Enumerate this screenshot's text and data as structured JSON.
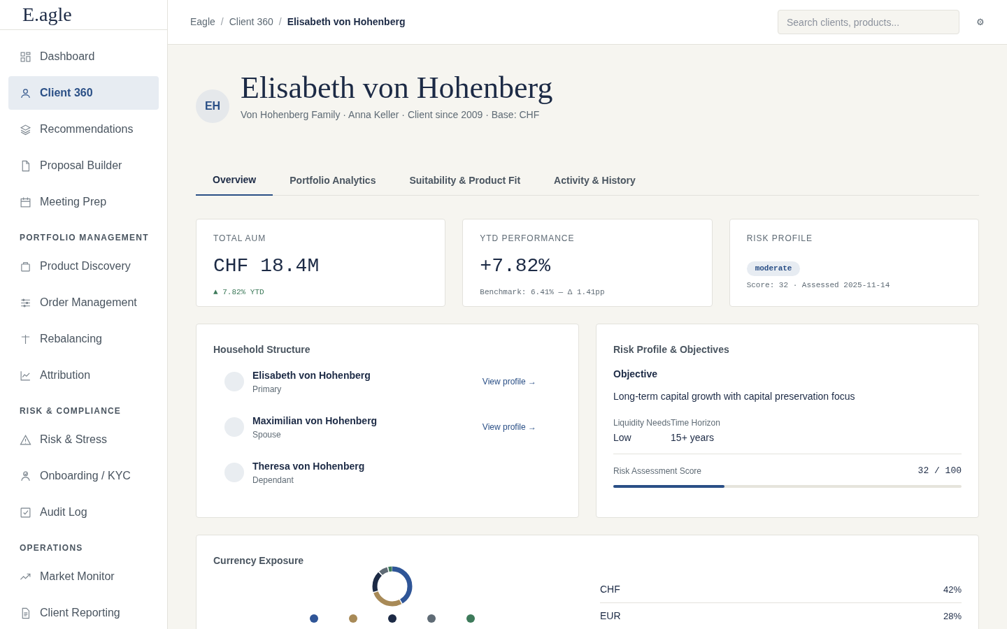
{
  "logo": "E.agle",
  "sidebar": {
    "sections": [
      {
        "items": [
          {
            "label": "Dashboard",
            "selected": false
          },
          {
            "label": "Client 360",
            "selected": true
          },
          {
            "label": "Recommendations",
            "selected": false
          },
          {
            "label": "Proposal Builder",
            "selected": false
          },
          {
            "label": "Meeting Prep",
            "selected": false
          }
        ]
      },
      {
        "heading": "PORTFOLIO MANAGEMENT",
        "items": [
          {
            "label": "Product Discovery",
            "selected": false
          },
          {
            "label": "Order Management",
            "selected": false
          },
          {
            "label": "Rebalancing",
            "selected": false
          },
          {
            "label": "Attribution",
            "selected": false
          }
        ]
      },
      {
        "heading": "RISK & COMPLIANCE",
        "items": [
          {
            "label": "Risk & Stress",
            "selected": false
          },
          {
            "label": "Onboarding / KYC",
            "selected": false
          },
          {
            "label": "Audit Log",
            "selected": false
          }
        ]
      },
      {
        "heading": "OPERATIONS",
        "items": [
          {
            "label": "Market Monitor",
            "selected": false
          },
          {
            "label": "Client Reporting",
            "selected": false
          }
        ]
      }
    ]
  },
  "breadcrumb": [
    "Eagle",
    "/",
    "Client 360",
    "/",
    "Elisabeth von Hohenberg"
  ],
  "search": {
    "placeholder": "Search clients, products..."
  },
  "settings_glyph": "⚙",
  "client": {
    "initials": "EH",
    "name": "Elisabeth von Hohenberg",
    "subtitle": "Von Hohenberg Family · Anna Keller · Client since 2009 · Base: CHF"
  },
  "tabs": [
    {
      "label": "Overview",
      "selected": true
    },
    {
      "label": "Portfolio Analytics",
      "selected": false
    },
    {
      "label": "Suitability & Product Fit",
      "selected": false
    },
    {
      "label": "Activity & History",
      "selected": false
    }
  ],
  "kpis": [
    {
      "kind": "value",
      "label": "TOTAL AUM",
      "value": "CHF 18.4M",
      "note": "▲ 7.82% YTD"
    },
    {
      "kind": "value",
      "label": "YTD PERFORMANCE",
      "value": "+7.82%",
      "note": "Benchmark: 6.41% — Δ 1.41pp"
    },
    {
      "kind": "badge",
      "label": "RISK PROFILE",
      "value": "moderate",
      "note": "Score: 32 · Assessed 2025-11-14"
    }
  ],
  "household": {
    "title": "Household Structure",
    "members": [
      {
        "name": "Elisabeth von Hohenberg",
        "role": "Primary",
        "link": "View profile →"
      },
      {
        "name": "Maximilian von Hohenberg",
        "role": "Spouse",
        "link": "View profile →"
      },
      {
        "name": "Theresa von Hohenberg",
        "role": "Dependant"
      }
    ]
  },
  "risk": {
    "title": "Risk Profile & Objectives",
    "objective_label": "Objective",
    "objective": "Long-term capital growth with capital preservation focus",
    "fields": [
      {
        "label": "Liquidity Needs",
        "value": "Low"
      },
      {
        "label": "Time Horizon",
        "value": "15+ years"
      }
    ],
    "score_label": "Risk Assessment Score",
    "score": "32 / 100",
    "level": 0.32
  },
  "currency": {
    "title": "Currency Exposure",
    "legend": [
      {
        "color": "#2f5597"
      },
      {
        "color": "#a88a57"
      },
      {
        "color": "#1c2a45"
      },
      {
        "color": "#5f6b75"
      },
      {
        "color": "#3d7a5a"
      }
    ],
    "rows": [
      {
        "code": "CHF",
        "share": "42%"
      },
      {
        "code": "EUR",
        "share": "28%"
      }
    ]
  }
}
